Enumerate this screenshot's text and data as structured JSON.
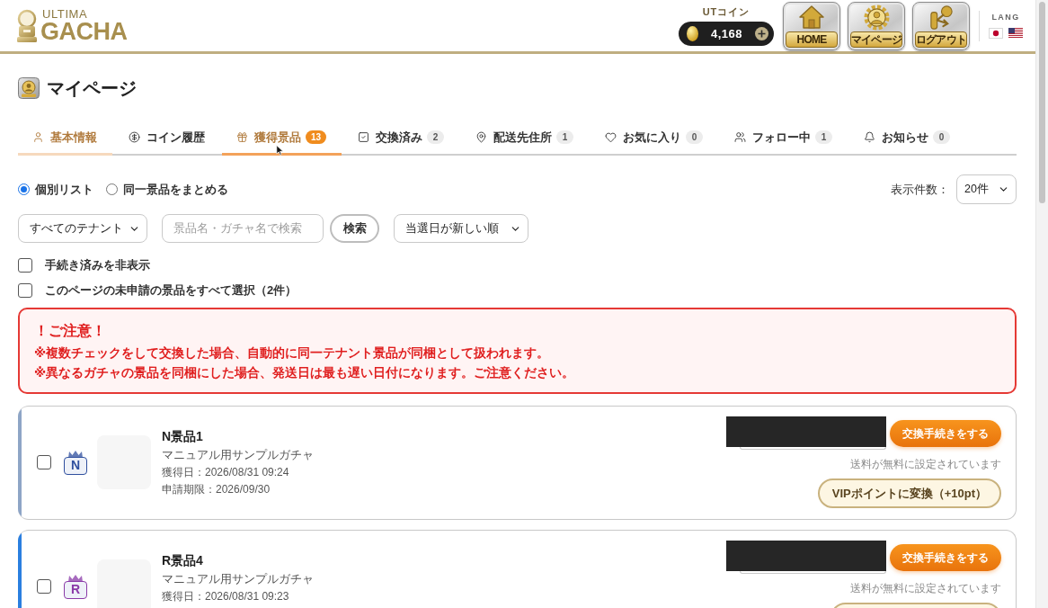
{
  "header": {
    "logo": {
      "line1": "ULTIMA",
      "line2": "GACHA"
    },
    "coins": {
      "label": "UTコイン",
      "amount": "4,168"
    },
    "nav_buttons": [
      {
        "label": "HOME"
      },
      {
        "label": "マイページ"
      },
      {
        "label": "ログアウト"
      }
    ],
    "lang": {
      "label": "LANG"
    }
  },
  "page": {
    "title": "マイページ"
  },
  "tabs": [
    {
      "label": "基本情報",
      "selected": false,
      "highlighted": true,
      "hovered": false
    },
    {
      "label": "コイン履歴",
      "selected": false,
      "highlighted": false,
      "hovered": false
    },
    {
      "label": "獲得景品",
      "count": "13",
      "selected": true,
      "highlighted": true,
      "hovered": true
    },
    {
      "label": "交換済み",
      "count": "2",
      "selected": false,
      "highlighted": false,
      "hovered": false
    },
    {
      "label": "配送先住所",
      "count": "1",
      "selected": false,
      "highlighted": false,
      "hovered": false
    },
    {
      "label": "お気に入り",
      "count": "0",
      "selected": false,
      "highlighted": false,
      "hovered": false
    },
    {
      "label": "フォロー中",
      "count": "1",
      "selected": false,
      "highlighted": false,
      "hovered": false
    },
    {
      "label": "お知らせ",
      "count": "0",
      "selected": false,
      "highlighted": false,
      "hovered": false
    }
  ],
  "view_modes": [
    {
      "label": "個別リスト",
      "selected": true
    },
    {
      "label": "同一景品をまとめる",
      "selected": false
    }
  ],
  "per_page": {
    "label": "表示件数：",
    "value": "20件"
  },
  "filters": {
    "tenant": "すべてのテナント",
    "search": {
      "placeholder": "景品名・ガチャ名で検索"
    },
    "search_button": "検索",
    "sort": "当選日が新しい順"
  },
  "options": [
    {
      "label": "手続き済みを非表示",
      "checked": false
    },
    {
      "label": "このページの未申請の景品をすべて選択（2件）",
      "checked": false
    }
  ],
  "notice": {
    "title": "！ご注意！",
    "lines": [
      "※複数チェックをして交換した場合、自動的に同一テナント景品が同梱として扱われます。",
      "※異なるガチャの景品を同梱にした場合、発送日は最も遅い日付になります。ご注意ください。"
    ]
  },
  "prizes": [
    {
      "rarity": "N",
      "color": "#8ea5c6",
      "badge": {
        "color": "#2f4f9e"
      },
      "checked": false,
      "name": "N景品1",
      "gacha": "マニュアル用サンプルガチャ",
      "acquired": "獲得日：2026/08/31 09:24",
      "deadline": "申請期限：2026/09/30",
      "redacted": true,
      "exchange_button": "交換手続きをする",
      "shipping_note": "送料が無料に設定されています",
      "convertible": true,
      "convert_label": "VIPポイントに変換（+10pt）"
    },
    {
      "rarity": "R",
      "color": "#2a7fe0",
      "badge": {
        "color": "#8a3aa8"
      },
      "checked": false,
      "name": "R景品4",
      "gacha": "マニュアル用サンプルガチャ",
      "acquired": "獲得日：2026/08/31 09:23",
      "redacted": true,
      "exchange_button": "交換手続きをする",
      "shipping_note": "送料が無料に設定されています",
      "convertible": true
    }
  ]
}
